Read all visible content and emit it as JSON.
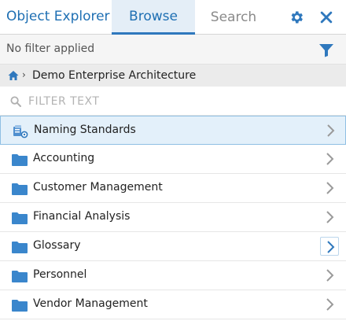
{
  "header": {
    "title": "Object Explorer",
    "tabs": [
      {
        "label": "Browse",
        "active": true
      },
      {
        "label": "Search",
        "active": false
      }
    ],
    "icons": [
      "gear-icon",
      "close-icon"
    ],
    "accent_color": "#1e6fb3"
  },
  "filter_bar": {
    "status": "No filter applied",
    "icon": "funnel-icon"
  },
  "breadcrumb": {
    "home_icon": "home-icon",
    "path": "Demo Enterprise Architecture"
  },
  "filter_input": {
    "placeholder": "FILTER TEXT",
    "value": ""
  },
  "items": [
    {
      "label": "Naming Standards",
      "icon": "naming-standards-icon",
      "selected": true
    },
    {
      "label": "Accounting",
      "icon": "folder-icon"
    },
    {
      "label": "Customer Management",
      "icon": "folder-icon"
    },
    {
      "label": "Financial Analysis",
      "icon": "folder-icon"
    },
    {
      "label": "Glossary",
      "icon": "folder-icon",
      "chevron_active": true
    },
    {
      "label": "Personnel",
      "icon": "folder-icon"
    },
    {
      "label": "Vendor Management",
      "icon": "folder-icon"
    }
  ],
  "colors": {
    "folder": "#3a86cc",
    "selected_bg": "#e3f0fa",
    "chevron": "#9a9a9a",
    "chevron_active": "#2f78bd"
  }
}
